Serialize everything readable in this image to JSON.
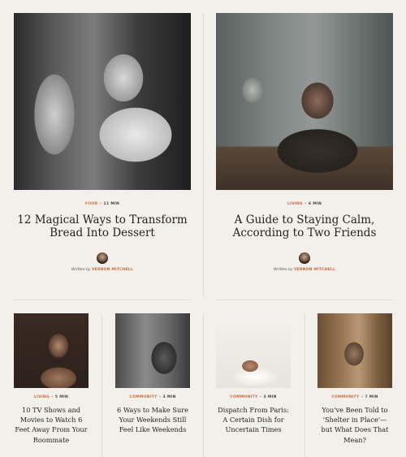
{
  "featured": [
    {
      "category": "FOOD",
      "read_time": "11 MIN",
      "title": "12 Magical Ways to Transform Bread Into Dessert",
      "written_by": "Written by",
      "author": "VERNON MITCHELL"
    },
    {
      "category": "LIVING",
      "read_time": "6 MIN",
      "title": "A Guide to Staying Calm, According to Two Friends",
      "written_by": "Written by",
      "author": "VERNON MITCHELL"
    }
  ],
  "small": [
    {
      "category": "LIVING",
      "read_time": "5 MIN",
      "title": "10 TV Shows and Movies to Watch 6 Feet Away From Your Roommate"
    },
    {
      "category": "COMMUNITY",
      "read_time": "3 MIN",
      "title": "6 Ways to Make Sure Your Weekends Still Feel Like Weekends"
    },
    {
      "category": "COMMUNITY",
      "read_time": "3 MIN",
      "title": "Dispatch From Paris: A Certain Dish for Uncertain Times"
    },
    {
      "category": "COMMUNITY",
      "read_time": "7 MIN",
      "title": "You've Been Told to 'Shelter in Place'—but What Does That Mean?"
    }
  ],
  "colors": {
    "accent": "#c7683e",
    "background": "#f3f0eb",
    "divider": "#e2ded7"
  },
  "icons": {
    "separator": "•"
  }
}
